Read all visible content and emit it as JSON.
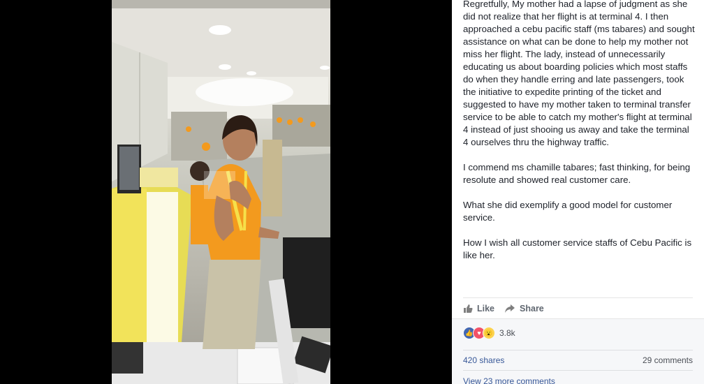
{
  "post": {
    "paragraphs": [
      "Regretfully, My mother had a lapse of judgment as she did not realize that her flight is at terminal 4. I then approached a cebu pacific staff (ms tabares) and sought assistance on what can be done to help my mother not miss her flight. The lady, instead of unnecessarily educating us about boarding policies which most staffs do when they handle erring and late passengers, took the initiative to expedite printing of the ticket and suggested to have my mother taken to terminal transfer service to be able to catch my mother's flight at terminal 4 instead of just shooing us away and take the terminal 4 ourselves thru the highway traffic.",
      "I commend ms chamille tabares; fast thinking, for being resolute and showed real customer care.",
      "What she did exemplify a good model for customer service.",
      "How I wish all customer service staffs of Cebu Pacific is like her."
    ]
  },
  "actions": {
    "like_label": "Like",
    "share_label": "Share"
  },
  "stats": {
    "reaction_count": "3.8k",
    "shares": "420 shares",
    "comments": "29 comments",
    "view_more": "View 23 more comments"
  },
  "colors": {
    "link": "#385898",
    "like_blue": "#4267b2",
    "love_red": "#f25268",
    "staff_orange": "#f39a1e"
  }
}
